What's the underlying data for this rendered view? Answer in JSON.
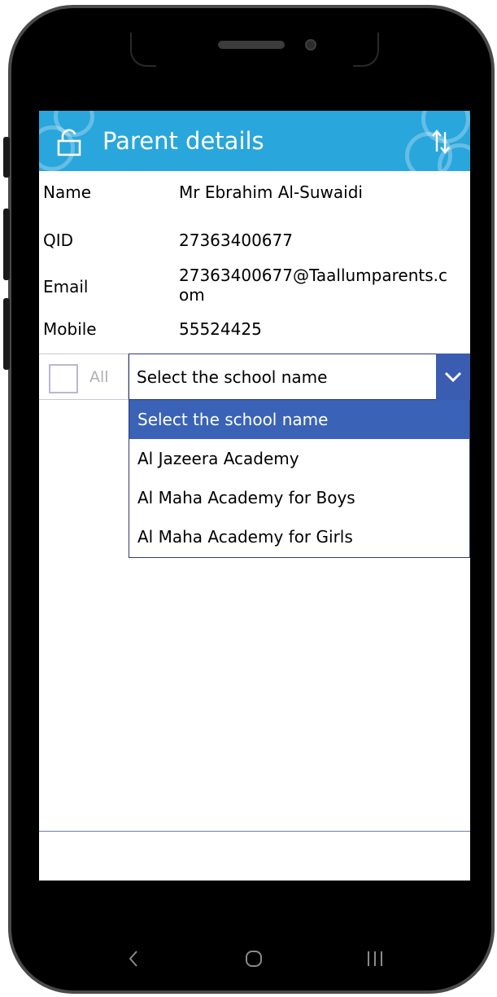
{
  "header": {
    "title": "Parent details"
  },
  "details": {
    "name_label": "Name",
    "name_value": "Mr Ebrahim Al-Suwaidi",
    "qid_label": "QID",
    "qid_value": "27363400677",
    "email_label": "Email",
    "email_value_line1": "27363400677@Taallumparents.c",
    "email_value_line2": "om",
    "mobile_label": "Mobile",
    "mobile_value": "55524425"
  },
  "filter": {
    "all_label": "All",
    "all_checked": false,
    "school_select_value": "Select the school name",
    "options": [
      "Select the school name",
      "Al Jazeera Academy",
      "Al Maha Academy for Boys",
      "Al Maha Academy for Girls"
    ],
    "selected_index": 0
  },
  "colors": {
    "header_bg": "#29a6dc",
    "select_button": "#3b5db1",
    "selected_option": "#3a62b6"
  },
  "icons": {
    "header_left": "lock-open-icon",
    "header_right": "sort-icon",
    "dropdown": "chevron-down-icon",
    "nav_back": "back-icon",
    "nav_home": "home-icon",
    "nav_recents": "recents-icon"
  }
}
